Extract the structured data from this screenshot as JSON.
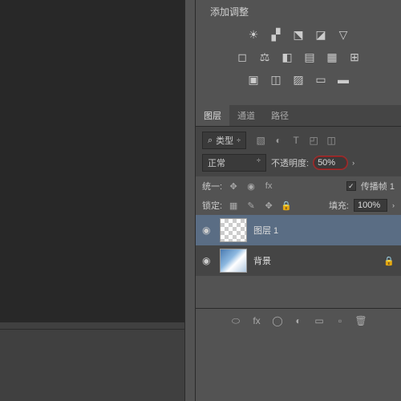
{
  "adjustments": {
    "title": "添加调整"
  },
  "tabs": {
    "layers": "图层",
    "channels": "通道",
    "paths": "路径"
  },
  "filter": {
    "kind_label": "类型"
  },
  "blend": {
    "mode": "正常",
    "opacity_label": "不透明度:",
    "opacity_value": "50%"
  },
  "unify": {
    "label": "统一:",
    "propagate_label": "传播帧 1"
  },
  "lock": {
    "label": "锁定:",
    "fill_label": "填充:",
    "fill_value": "100%"
  },
  "layers": [
    {
      "name": "图层 1",
      "locked": false,
      "selected": true,
      "thumb": "checker"
    },
    {
      "name": "背景",
      "locked": true,
      "selected": false,
      "thumb": "img"
    }
  ],
  "icons": {
    "search": "⌕",
    "brightness": "☀",
    "levels": "▞",
    "curves": "⬔",
    "exposure": "◪",
    "triangle": "▽",
    "square": "◻",
    "balance": "⚖",
    "bw": "◧",
    "photo": "▤",
    "lookup": "⊞",
    "checker": "▦",
    "invert": "▣",
    "poster": "◫",
    "thresh": "▨",
    "grad": "▭",
    "sel": "▬",
    "eye": "◉",
    "lock": "🔒",
    "fx": "fx",
    "link": "⬭",
    "mask": "◯",
    "folder": "▭",
    "new": "▫",
    "trash": "🗑"
  }
}
